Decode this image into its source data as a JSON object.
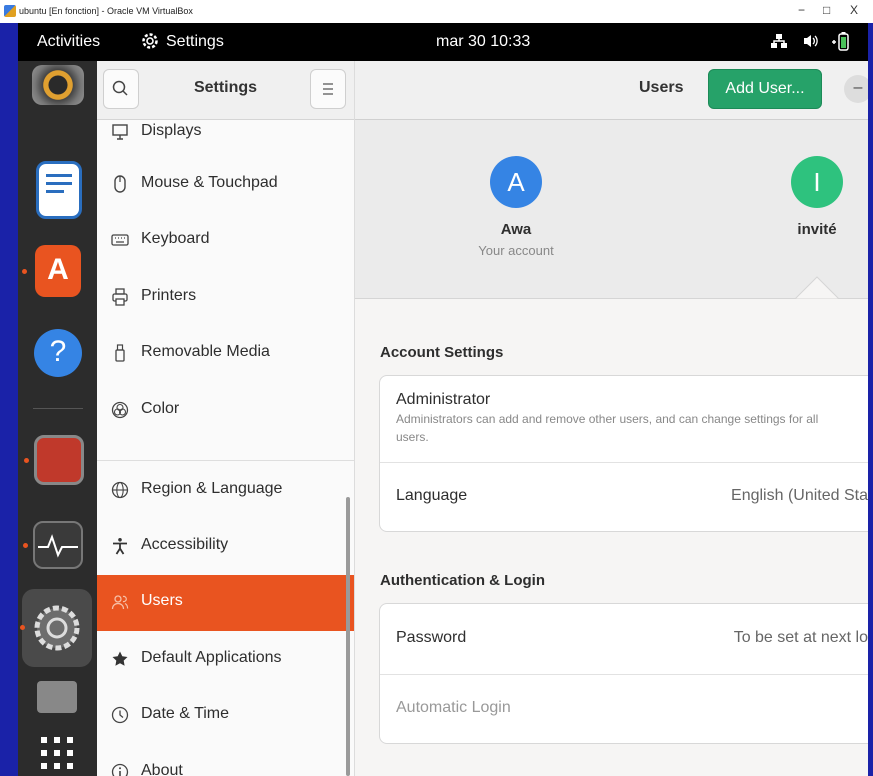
{
  "vbox": {
    "title": "ubuntu [En fonction] - Oracle VM VirtualBox",
    "min": "−",
    "max": "□",
    "close": "X"
  },
  "topbar": {
    "activities": "Activities",
    "app_name": "Settings",
    "clock": "mar 30 10:33"
  },
  "sidebar": {
    "title": "Settings",
    "items": [
      {
        "label": "Displays",
        "icon": "display-icon"
      },
      {
        "label": "Mouse & Touchpad",
        "icon": "mouse-icon"
      },
      {
        "label": "Keyboard",
        "icon": "keyboard-icon"
      },
      {
        "label": "Printers",
        "icon": "printer-icon"
      },
      {
        "label": "Removable Media",
        "icon": "usb-icon"
      },
      {
        "label": "Color",
        "icon": "color-icon"
      },
      {
        "label": "Region & Language",
        "icon": "globe-icon"
      },
      {
        "label": "Accessibility",
        "icon": "accessibility-icon"
      },
      {
        "label": "Users",
        "icon": "users-icon"
      },
      {
        "label": "Default Applications",
        "icon": "star-icon"
      },
      {
        "label": "Date & Time",
        "icon": "clock-icon"
      },
      {
        "label": "About",
        "icon": "info-icon"
      }
    ],
    "active": "Users"
  },
  "main": {
    "header_title": "Users",
    "add_user_label": "Add User...",
    "remove_label": "–",
    "users": [
      {
        "initial": "A",
        "name": "Awa",
        "subtitle": "Your account",
        "color": "#3584e4"
      },
      {
        "initial": "I",
        "name": "invité",
        "color": "#2ec27e"
      }
    ],
    "account_settings": {
      "title": "Account Settings",
      "admin_label": "Administrator",
      "admin_desc_1": "Administrators can add and remove other users, and can change settings for all",
      "admin_desc_2": "users.",
      "language_label": "Language",
      "language_value": "English (United Sta"
    },
    "auth": {
      "title": "Authentication & Login",
      "password_label": "Password",
      "password_value": "To be set at next lo",
      "autologin_label": "Automatic Login"
    }
  },
  "colors": {
    "accent": "#e95420",
    "add_button": "#26a269",
    "dock": "#2c2c2c",
    "remove_user_button": "#e01b24"
  }
}
